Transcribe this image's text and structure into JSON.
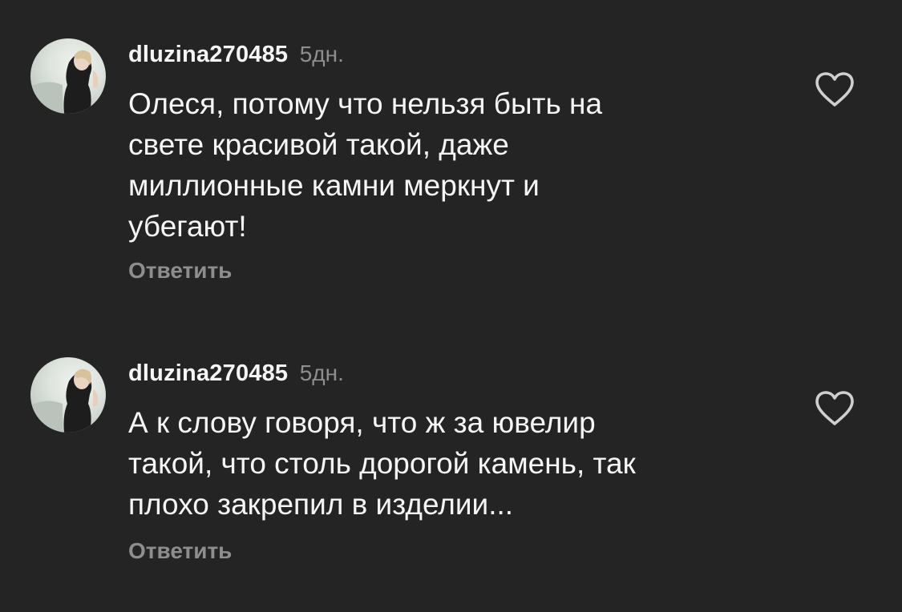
{
  "comments": [
    {
      "username": "dluzina270485",
      "time": "5дн.",
      "text": "Олеся, потому что нельзя быть на\nсвете красивой такой, даже\nмиллионные камни меркнут и\nубегают!",
      "reply_label": "Ответить",
      "like_icon": "heart-outline-icon"
    },
    {
      "username": "dluzina270485",
      "time": "5дн.",
      "text": "А к слову говоря, что ж за ювелир\nтакой, что столь дорогой камень, так\nплохо закрепил в изделии...",
      "reply_label": "Ответить",
      "like_icon": "heart-outline-icon"
    }
  ],
  "colors": {
    "background": "#242424",
    "primary_text": "#f5f5f5",
    "secondary_text": "#8e8e8e"
  }
}
